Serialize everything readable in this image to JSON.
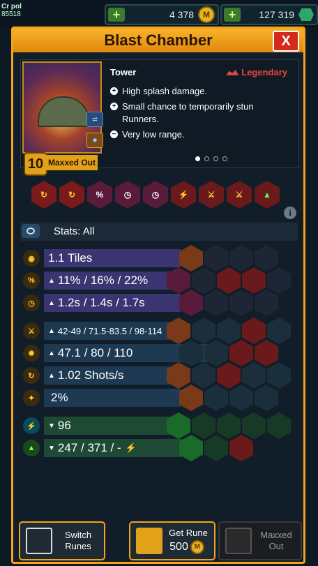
{
  "hud": {
    "player_name": "Cr pol",
    "player_id": "85518",
    "coins": "4 378",
    "coin_symbol": "M",
    "gems": "127 319"
  },
  "panel": {
    "title": "Blast Chamber",
    "close_label": "X"
  },
  "card": {
    "type": "Tower",
    "rarity": "Legendary",
    "level": "10",
    "status": "Maxxed Out",
    "descriptions": [
      {
        "sign": "+",
        "text": "High splash damage."
      },
      {
        "sign": "+",
        "text": "Small chance to temporarily stun Runners."
      },
      {
        "sign": "−",
        "text": "Very low range."
      }
    ],
    "page_dots": 4,
    "page_active": 0
  },
  "stats_header": {
    "label": "Stats: All"
  },
  "stats": [
    {
      "value": "1.1 Tiles",
      "arrow": "",
      "group": "purple"
    },
    {
      "value": "11% / 16% / 22%",
      "arrow": "▲",
      "group": "purple"
    },
    {
      "value": "1.2s / 1.4s / 1.7s",
      "arrow": "▲",
      "group": "purple"
    },
    {
      "value": "42-49 / 71.5-83.5 / 98-114",
      "arrow": "▲",
      "group": "blue"
    },
    {
      "value": "47.1 / 80 / 110",
      "arrow": "▲",
      "group": "blue"
    },
    {
      "value": "1.02 Shots/s",
      "arrow": "▲",
      "group": "blue"
    },
    {
      "value": "2%",
      "arrow": "",
      "group": "blue"
    },
    {
      "value": "96",
      "arrow": "▼",
      "group": "green"
    },
    {
      "value": "247 / 371 / -",
      "arrow": "▼",
      "group": "green"
    }
  ],
  "buttons": {
    "switch": "Switch Runes",
    "get_rune": "Get Rune",
    "get_rune_cost": "500",
    "maxxed": "Maxxed Out"
  },
  "colors": {
    "accent": "#f4a21a",
    "purple_bar": "#3a3470",
    "blue_bar": "#1e3a52",
    "green_bar": "#1e4a34",
    "legendary": "#e6463a"
  }
}
